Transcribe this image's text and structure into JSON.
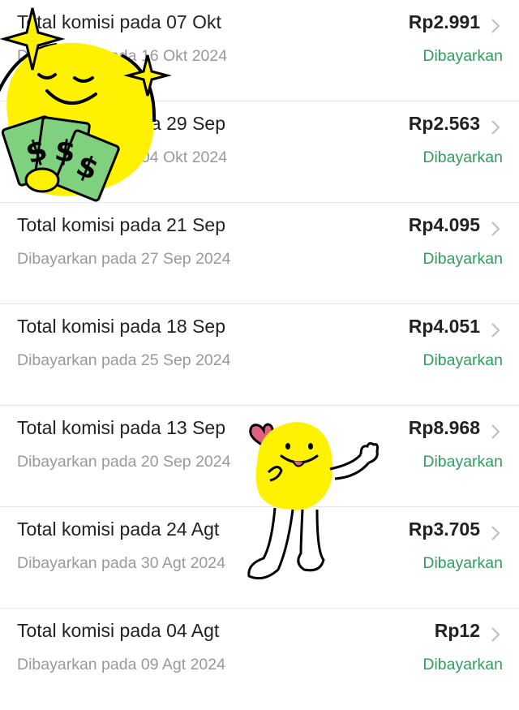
{
  "commissions": [
    {
      "title": "Total komisi pada 07 Okt",
      "paid_on": "Dibayarkan pada 16 Okt 2024",
      "amount": "Rp2.991",
      "status": "Dibayarkan"
    },
    {
      "title": "Total komisi pada 29 Sep",
      "paid_on": "Dibayarkan pada 04 Okt 2024",
      "amount": "Rp2.563",
      "status": "Dibayarkan"
    },
    {
      "title": "Total komisi pada 21 Sep",
      "paid_on": "Dibayarkan pada 27 Sep 2024",
      "amount": "Rp4.095",
      "status": "Dibayarkan"
    },
    {
      "title": "Total komisi pada 18 Sep",
      "paid_on": "Dibayarkan pada 25 Sep 2024",
      "amount": "Rp4.051",
      "status": "Dibayarkan"
    },
    {
      "title": "Total komisi pada 13 Sep",
      "paid_on": "Dibayarkan pada 20 Sep 2024",
      "amount": "Rp8.968",
      "status": "Dibayarkan"
    },
    {
      "title": "Total komisi pada 24 Agt",
      "paid_on": "Dibayarkan pada 30 Agt 2024",
      "amount": "Rp3.705",
      "status": "Dibayarkan"
    },
    {
      "title": "Total komisi pada 04 Agt",
      "paid_on": "Dibayarkan pada 09 Agt 2024",
      "amount": "Rp12",
      "status": "Dibayarkan"
    }
  ],
  "colors": {
    "status": "#2e9e5e",
    "text": "#222222",
    "muted": "#999999",
    "sticker": "#fff200",
    "money": "#7fd07f"
  },
  "icons": {
    "row_arrow": "chevron-right-icon",
    "sticker_top": "lemon-money-sticker",
    "sticker_bottom": "lemon-heart-sticker"
  }
}
